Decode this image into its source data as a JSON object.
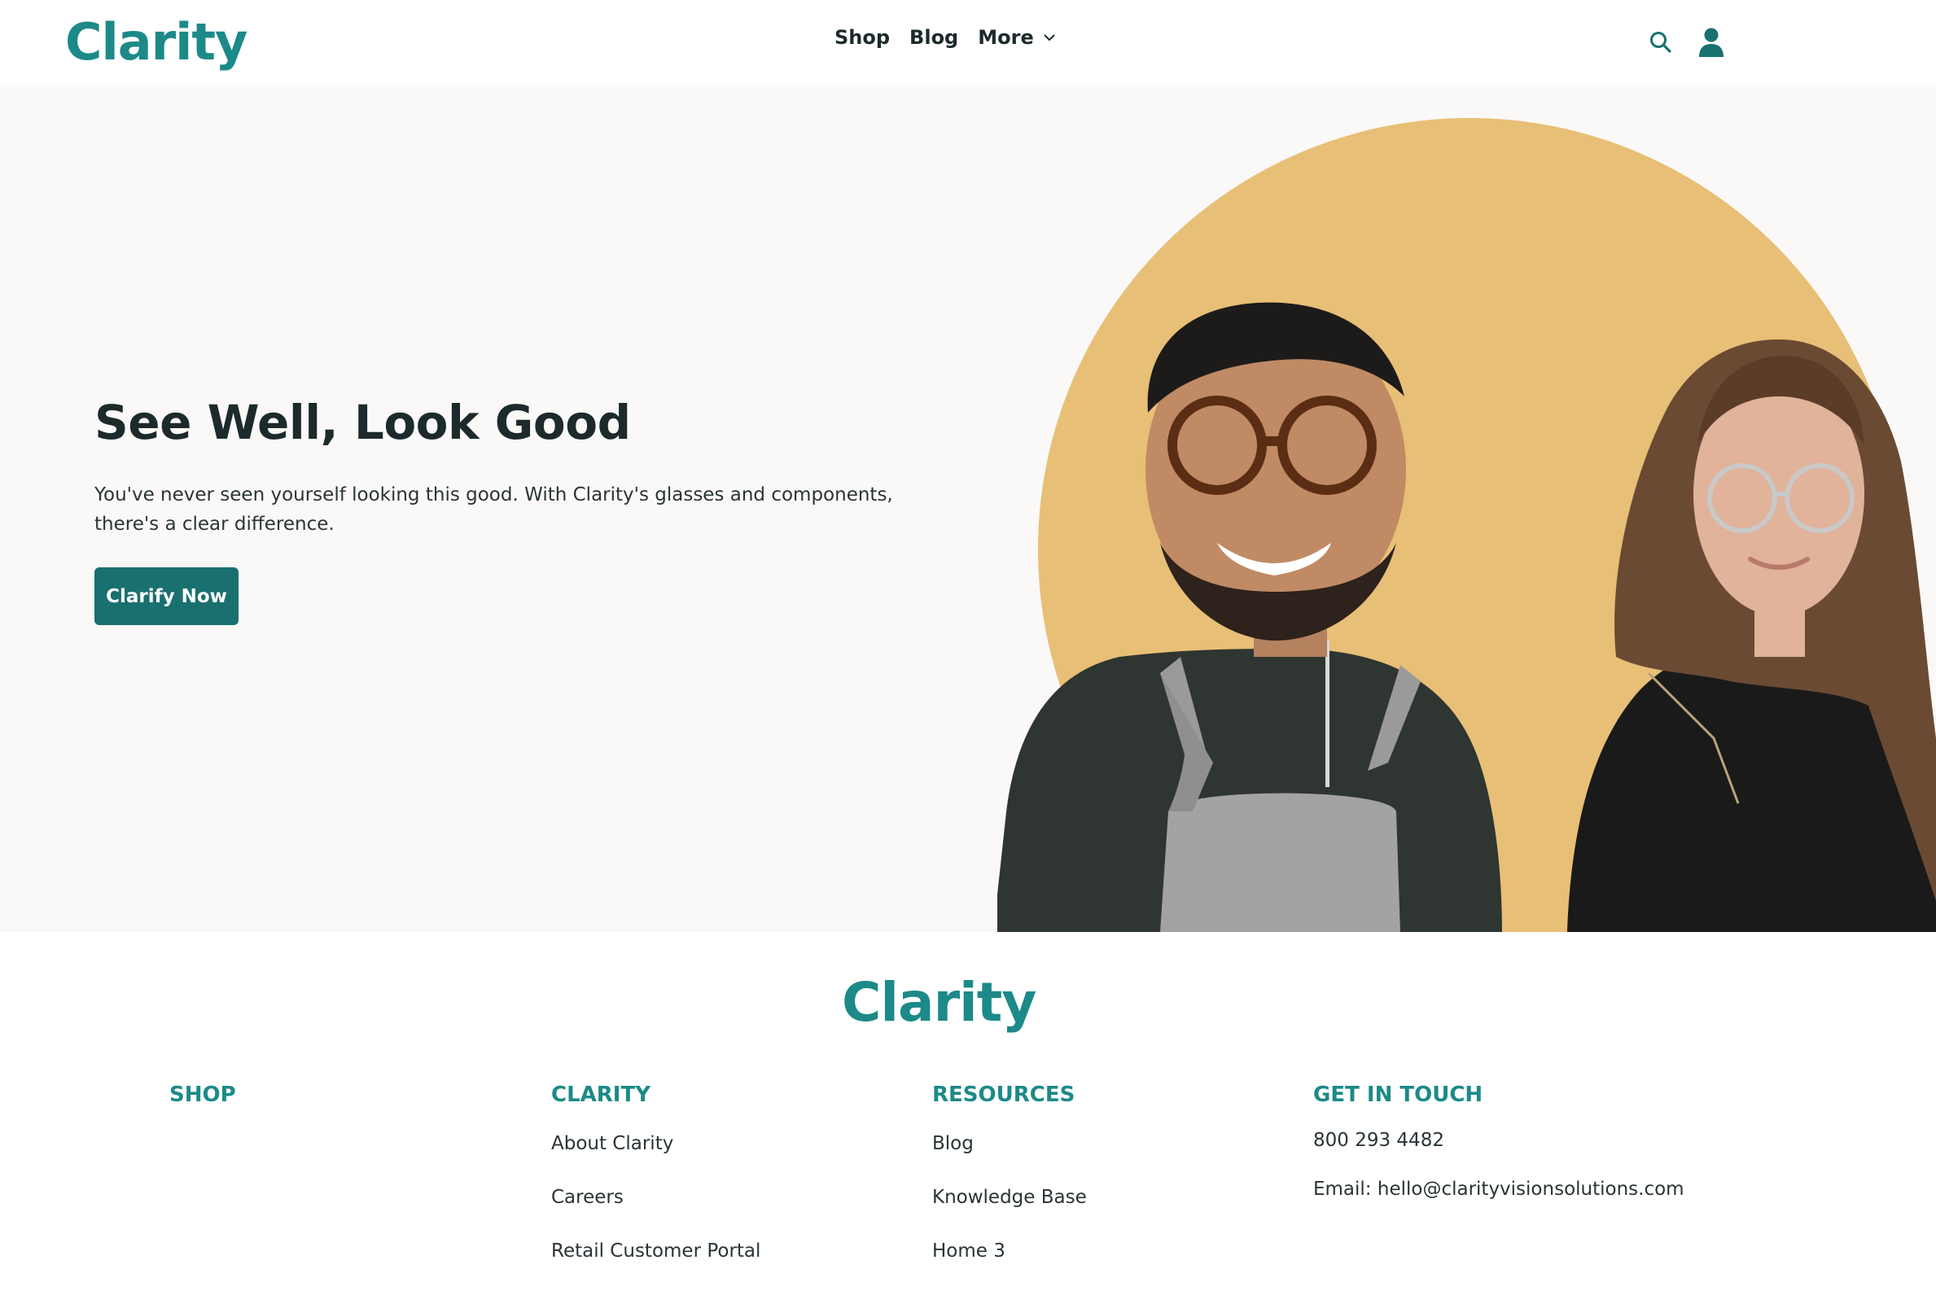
{
  "header": {
    "logo": "Clarity",
    "nav": [
      {
        "label": "Shop"
      },
      {
        "label": "Blog"
      },
      {
        "label": "More"
      }
    ],
    "icons": [
      "search-icon",
      "user-icon"
    ]
  },
  "hero": {
    "title": "See Well, Look Good",
    "text": "You've never seen yourself looking this good. With Clarity's glasses and components, there's a clear difference.",
    "button_label": "Clarify Now",
    "circle_color": "#e8bf76"
  },
  "footer": {
    "logo": "Clarity",
    "columns": [
      {
        "title": "SHOP",
        "links": []
      },
      {
        "title": "CLARITY",
        "links": [
          "About Clarity",
          "Careers",
          "Retail Customer Portal"
        ]
      },
      {
        "title": "RESOURCES",
        "links": [
          "Blog",
          "Knowledge Base",
          "Home 3"
        ]
      },
      {
        "title": "GET IN TOUCH",
        "lines": [
          "800 293 4482",
          "Email: hello@clarityvisionsolutions.com"
        ]
      }
    ]
  },
  "colors": {
    "brand": "#1c8a88",
    "button": "#19706f",
    "hero_bg": "#faf9f7"
  }
}
